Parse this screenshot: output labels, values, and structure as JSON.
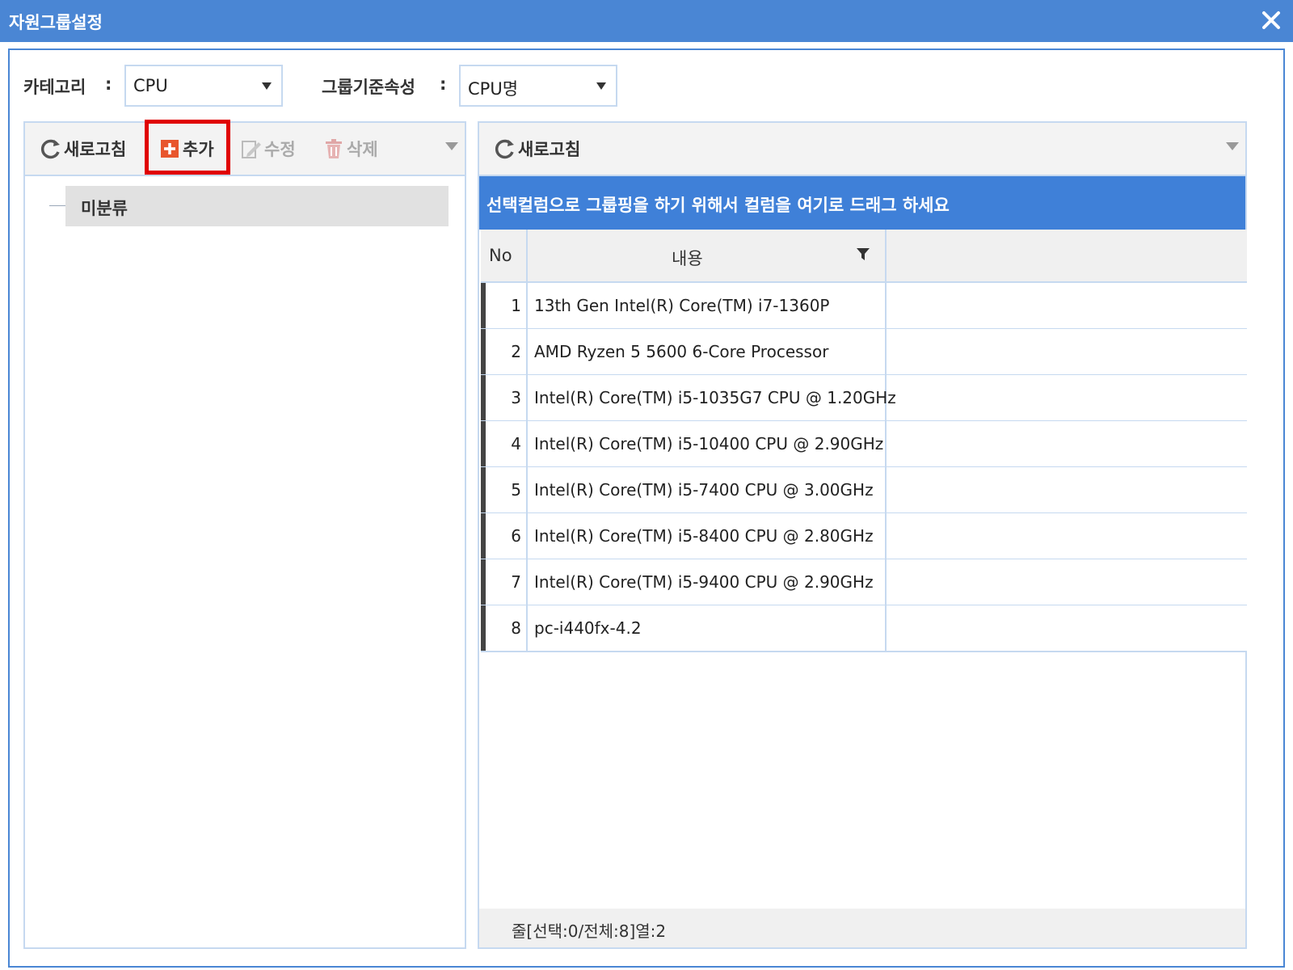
{
  "window": {
    "title": "자원그룹설정",
    "close_icon": "close-icon",
    "accent_color": "#4a86d4"
  },
  "filters": {
    "category_label": "카테고리",
    "category_sep": ":",
    "category_value": "CPU",
    "group_attr_label": "그룹기준속성",
    "group_attr_sep": ":",
    "group_attr_value": "CPU명"
  },
  "left_panel": {
    "toolbar": {
      "refresh": {
        "label": "새로고침",
        "icon": "refresh-icon"
      },
      "add": {
        "label": "추가",
        "icon": "plus-icon",
        "highlighted": true,
        "highlight_color": "#e00000"
      },
      "edit": {
        "label": "수정",
        "icon": "edit-icon",
        "disabled": true
      },
      "delete": {
        "label": "삭제",
        "icon": "trash-icon",
        "disabled": true
      }
    },
    "tree": [
      {
        "label": "미분류",
        "selected": true
      }
    ]
  },
  "right_panel": {
    "toolbar": {
      "refresh": {
        "label": "새로고침",
        "icon": "refresh-icon"
      }
    },
    "group_panel_text": "선택컬럼으로 그룹핑을 하기 위해서 컬럼을 여기로 드래그 하세요",
    "group_panel_color": "#3f80d8",
    "columns": [
      {
        "label": "No"
      },
      {
        "label": "내용",
        "filter_icon": "filter-icon"
      },
      {
        "label": ""
      }
    ],
    "rows": [
      {
        "no": "1",
        "content": "13th Gen Intel(R) Core(TM) i7-1360P"
      },
      {
        "no": "2",
        "content": "AMD Ryzen 5 5600 6-Core Processor"
      },
      {
        "no": "3",
        "content": "Intel(R) Core(TM) i5-1035G7 CPU @ 1.20GHz"
      },
      {
        "no": "4",
        "content": "Intel(R) Core(TM) i5-10400 CPU @ 2.90GHz"
      },
      {
        "no": "5",
        "content": "Intel(R) Core(TM) i5-7400 CPU @ 3.00GHz"
      },
      {
        "no": "6",
        "content": "Intel(R) Core(TM) i5-8400 CPU @ 2.80GHz"
      },
      {
        "no": "7",
        "content": "Intel(R) Core(TM) i5-9400 CPU @ 2.90GHz"
      },
      {
        "no": "8",
        "content": "pc-i440fx-4.2"
      }
    ],
    "status": "줄[선택:0/전체:8]열:2"
  }
}
